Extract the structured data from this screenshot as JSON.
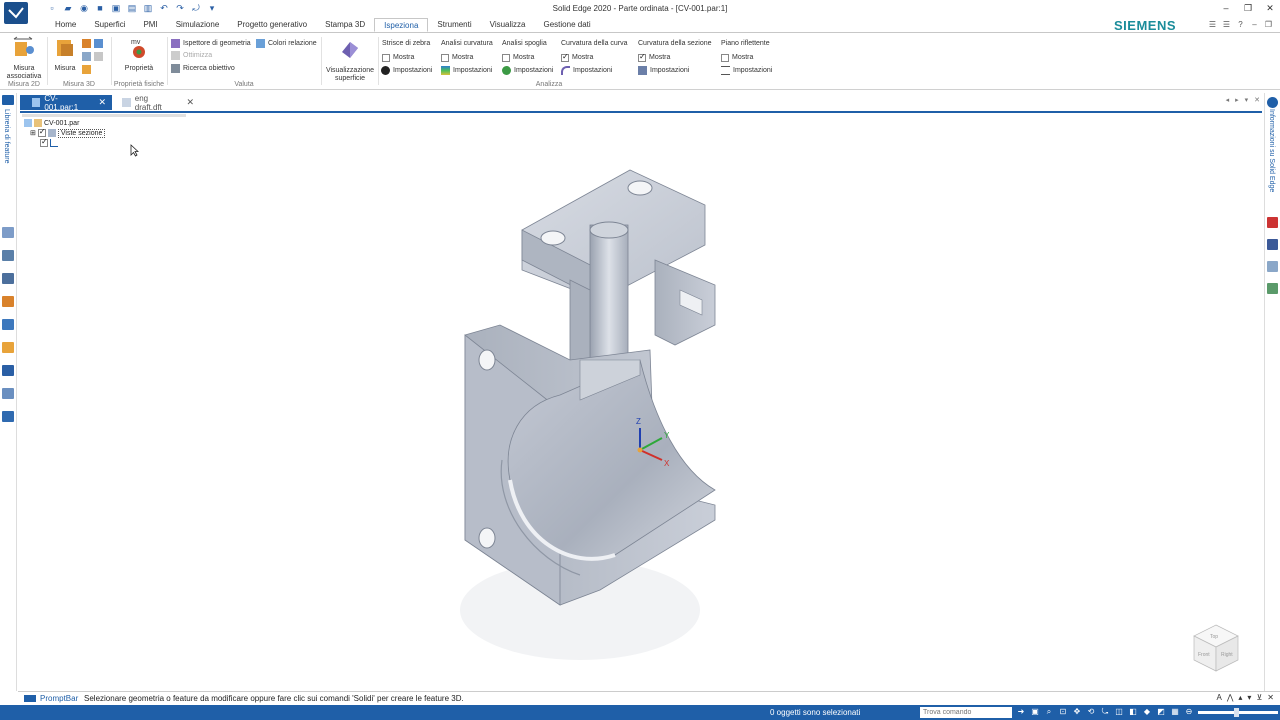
{
  "window": {
    "title": "Solid Edge 2020 - Parte ordinata - [CV-001.par:1]"
  },
  "ribbon_tabs": [
    "Home",
    "Superfici",
    "PMI",
    "Simulazione",
    "Progetto generativo",
    "Stampa 3D",
    "Ispeziona",
    "Strumenti",
    "Visualizza",
    "Gestione dati"
  ],
  "active_tab": "Ispeziona",
  "brand": "SIEMENS",
  "ribbon": {
    "misura2d": {
      "button": "Misura associativa",
      "label": "Misura 2D"
    },
    "misura3d": {
      "button": "Misura",
      "label": "Misura 3D"
    },
    "proprieta": {
      "button": "Proprietà",
      "label": "Proprietà fisiche"
    },
    "valuta": {
      "ispettore": "Ispettore di geometria",
      "colori": "Colori relazione",
      "ottimizza": "Ottimizza",
      "ricerca": "Ricerca obiettivo",
      "label": "Valuta"
    },
    "visualizzazione": "Visualizzazione superficie",
    "analizza": {
      "label": "Analizza",
      "columns": [
        {
          "title": "Strisce di zebra",
          "show": "Mostra",
          "checked": false,
          "settings": "Impostazioni"
        },
        {
          "title": "Analisi curvatura",
          "show": "Mostra",
          "checked": false,
          "settings": "Impostazioni"
        },
        {
          "title": "Analisi spoglia",
          "show": "Mostra",
          "checked": false,
          "settings": "Impostazioni"
        },
        {
          "title": "Curvatura della curva",
          "show": "Mostra",
          "checked": true,
          "settings": "Impostazioni"
        },
        {
          "title": "Curvatura della sezione",
          "show": "Mostra",
          "checked": true,
          "settings": "Impostazioni"
        },
        {
          "title": "Piano riflettente",
          "show": "Mostra",
          "checked": false,
          "settings": "Impostazioni"
        }
      ]
    }
  },
  "doc_tabs": [
    {
      "label": "CV-001.par:1",
      "active": true
    },
    {
      "label": "eng draft.dft",
      "active": false
    }
  ],
  "left_panel": {
    "title": "Libreria di feature"
  },
  "right_panel": {
    "title": "Informazioni su Solid Edge"
  },
  "pathfinder": {
    "root": "CV-001.par",
    "items": [
      "Viste sezione",
      ""
    ]
  },
  "triad": {
    "z": "Z",
    "x": "X",
    "y": "Y"
  },
  "viewcube": {
    "top": "Top",
    "front": "Front",
    "right": "Right"
  },
  "promptbar": {
    "label": "PromptBar",
    "text": "Selezionare geometria o feature da modificare oppure fare clic sui comandi 'Solidi' per creare le feature 3D."
  },
  "statusbar": {
    "selection": "0 oggetti sono selezionati",
    "search_placeholder": "Trova comando"
  },
  "colors": {
    "accent": "#1f5fa8",
    "siemens": "#1a8c9a",
    "part": "#b9bfcb"
  }
}
